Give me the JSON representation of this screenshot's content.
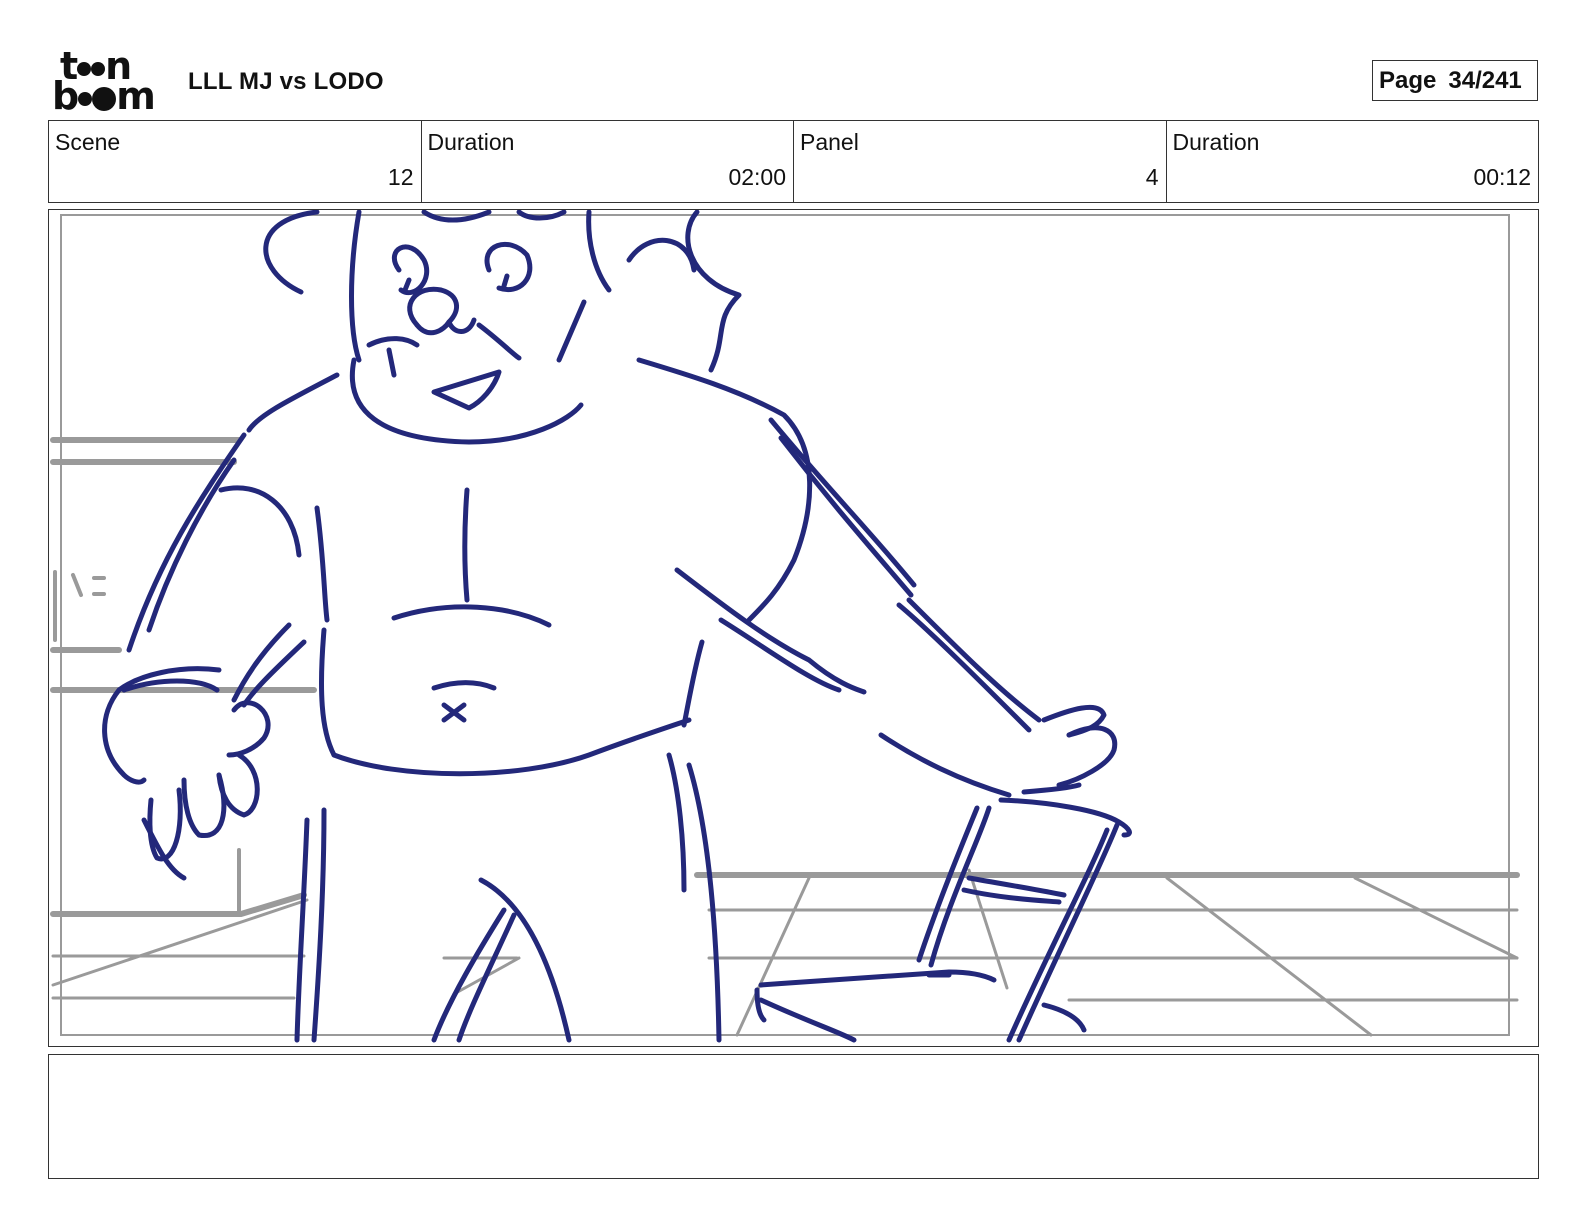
{
  "logo": {
    "text": "toon boom"
  },
  "header": {
    "title": "LLL MJ vs LODO",
    "page_label": "Page",
    "page_value": "34/241"
  },
  "info": {
    "scene_label": "Scene",
    "scene_value": "12",
    "scene_duration_label": "Duration",
    "scene_duration_value": "02:00",
    "panel_label": "Panel",
    "panel_value": "4",
    "panel_duration_label": "Duration",
    "panel_duration_value": "00:12"
  },
  "panel": {
    "sketch_color": "#23287a",
    "background_color": "#9a9a9a"
  },
  "notes": {
    "text": ""
  }
}
